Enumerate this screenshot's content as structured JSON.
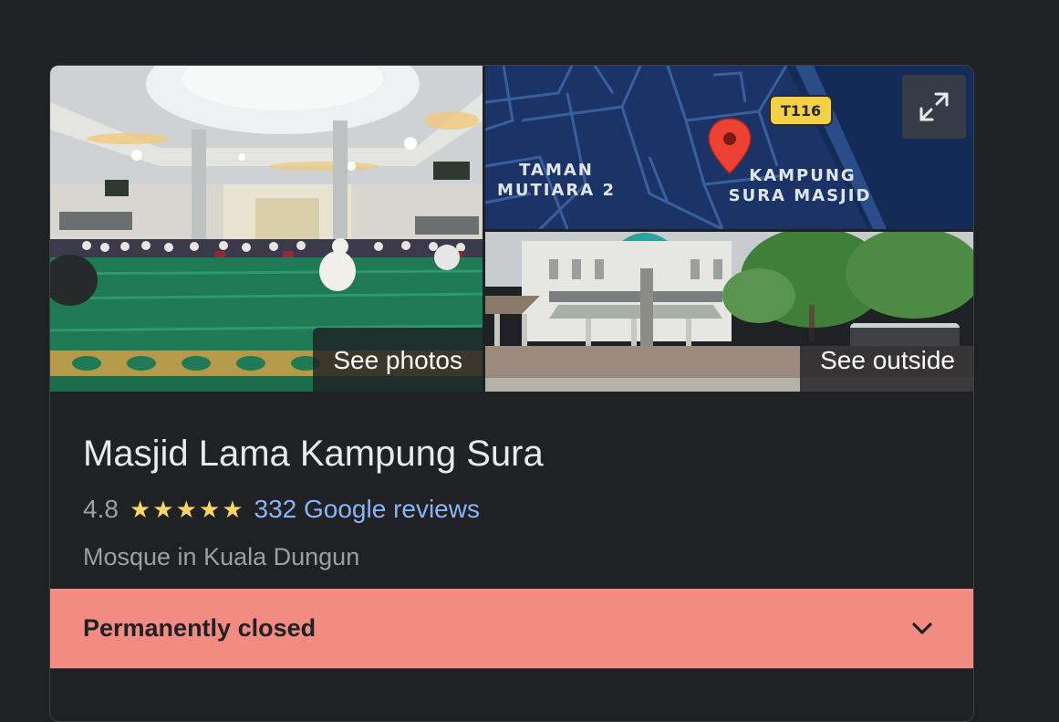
{
  "gallery": {
    "see_photos_label": "See photos",
    "see_outside_label": "See outside",
    "map": {
      "area_label_1_line1": "TAMAN",
      "area_label_1_line2": "MUTIARA 2",
      "area_label_2_line1": "KAMPUNG",
      "area_label_2_line2": "SURA MASJID",
      "road_shield": "T116"
    }
  },
  "place": {
    "title": "Masjid Lama Kampung Sura",
    "rating": "4.8",
    "star_count": 5,
    "reviews_link": "332 Google reviews",
    "category": "Mosque in Kuala Dungun",
    "status": "Permanently closed"
  },
  "colors": {
    "background": "#202124",
    "title_text": "#e8eaed",
    "muted_text": "#9aa0a6",
    "link": "#8ab4f8",
    "star": "#fdd663",
    "closed_banner": "#f28b82",
    "map_water": "#1f2f5a",
    "map_land": "#1b3366"
  },
  "icons": {
    "expand": "expand-icon",
    "pin": "map-pin-icon",
    "star": "star-icon",
    "chevron": "chevron-down-icon"
  }
}
